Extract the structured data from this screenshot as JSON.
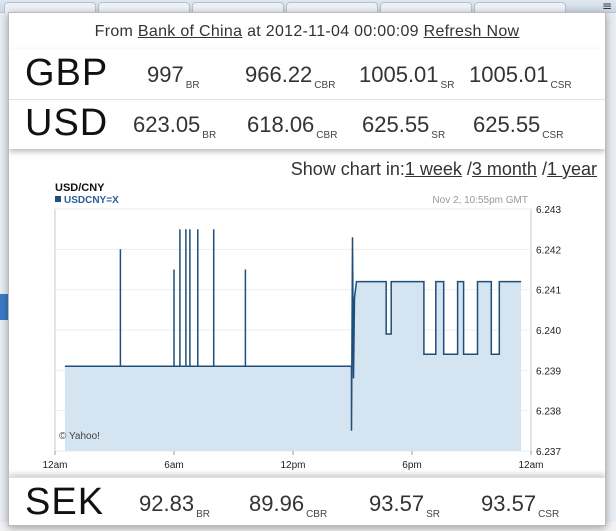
{
  "header": {
    "prefix": "From ",
    "bank_link": "Bank of China",
    "at_text": " at 2012-11-04 00:00:09 ",
    "refresh_link": "Refresh Now"
  },
  "rates": [
    {
      "code": "GBP",
      "br": "997",
      "cbr": "966.22",
      "sr": "1005.01",
      "csr": "1005.01"
    },
    {
      "code": "USD",
      "br": "623.05",
      "cbr": "618.06",
      "sr": "625.55",
      "csr": "625.55"
    }
  ],
  "bottom_rate": {
    "code": "SEK",
    "br": "92.83",
    "cbr": "89.96",
    "sr": "93.57",
    "csr": "93.57"
  },
  "sub_labels": {
    "br": "BR",
    "cbr": "CBR",
    "sr": "SR",
    "csr": "CSR"
  },
  "chart_links": {
    "label": "Show chart in:",
    "week": "1 week",
    "month": "3 month",
    "year": "1 year",
    "sep": " /"
  },
  "chart_data": {
    "type": "line",
    "title": "USD/CNY",
    "legend": "USDCNY=X",
    "timestamp": "Nov 2, 10:55pm GMT",
    "source": "© Yahoo!",
    "x_ticks": [
      "12am",
      "6am",
      "12pm",
      "6pm",
      "12am"
    ],
    "y_ticks": [
      "6.243",
      "6.242",
      "6.241",
      "6.240",
      "6.239",
      "6.238",
      "6.237"
    ],
    "ylim": [
      6.237,
      6.243
    ],
    "xlim": [
      0,
      24
    ],
    "line_color": "#1f4e79",
    "fill_color": "#d4e4f1",
    "x": [
      0.5,
      3.3,
      3.3,
      3.3,
      6.0,
      6.0,
      6.0,
      6.3,
      6.3,
      6.3,
      6.6,
      6.6,
      6.6,
      6.8,
      6.8,
      6.8,
      7.2,
      7.2,
      7.2,
      8.0,
      8.0,
      8.0,
      9.6,
      9.6,
      9.6,
      14.95,
      14.95,
      15.0,
      15.05,
      15.1,
      15.2,
      15.3,
      16.7,
      16.7,
      16.95,
      16.95,
      17.5,
      17.5,
      18.6,
      18.6,
      19.2,
      19.2,
      19.6,
      19.6,
      20.3,
      20.3,
      20.6,
      20.6,
      21.3,
      21.3,
      22.0,
      22.0,
      22.4,
      22.4,
      22.8,
      22.8,
      23.5
    ],
    "y": [
      6.2391,
      6.2391,
      6.242,
      6.2391,
      6.2391,
      6.2415,
      6.2391,
      6.2391,
      6.2425,
      6.2391,
      6.2391,
      6.2425,
      6.2391,
      6.2391,
      6.2425,
      6.2391,
      6.2391,
      6.2425,
      6.2391,
      6.2391,
      6.2425,
      6.2391,
      6.2391,
      6.2415,
      6.2391,
      6.2391,
      6.2375,
      6.2423,
      6.2388,
      6.2408,
      6.2412,
      6.2412,
      6.2412,
      6.2399,
      6.2399,
      6.2412,
      6.2412,
      6.2412,
      6.2412,
      6.2394,
      6.2394,
      6.2412,
      6.2412,
      6.2394,
      6.2394,
      6.2412,
      6.2412,
      6.2394,
      6.2394,
      6.2412,
      6.2412,
      6.2394,
      6.2394,
      6.2412,
      6.2412,
      6.2412,
      6.2412
    ]
  }
}
